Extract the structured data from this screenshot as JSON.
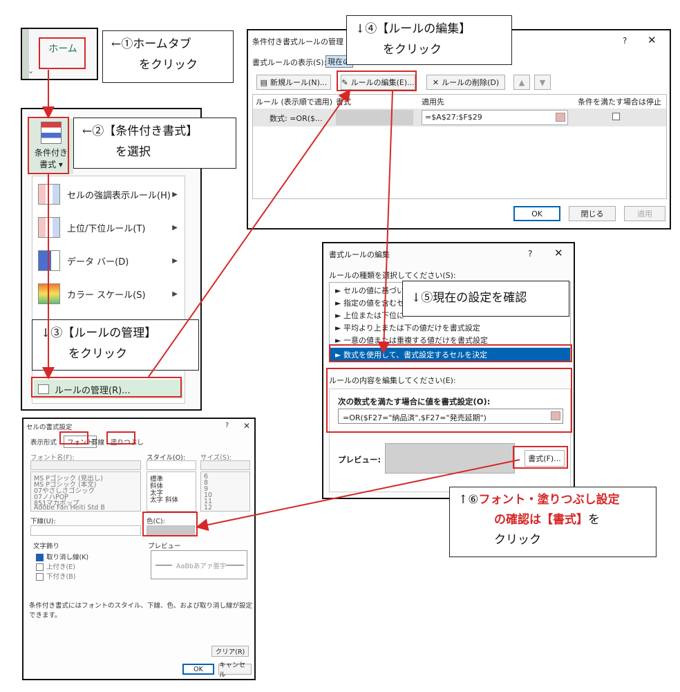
{
  "colors": {
    "accent_red": "#d62828",
    "excel_green": "#217346",
    "selected_blue": "#0063b1"
  },
  "home_tab": {
    "label": "ホーム"
  },
  "callouts": {
    "c1": [
      "←①ホームタブ",
      "をクリック"
    ],
    "c2": [
      "←②【条件付き書式】",
      "を選択"
    ],
    "c3": [
      "↓③【ルールの管理】",
      "をクリック"
    ],
    "c4": [
      "↓④【ルールの編集】",
      "をクリック"
    ],
    "c5": "↓⑤現在の設定を確認",
    "c6": {
      "prefix": "↑⑥",
      "red1": "フォント・塗りつぶし設定",
      "red2": "の確認は【書式】",
      "suffix": "を",
      "line3": "クリック"
    }
  },
  "cond_format_button": {
    "line1": "条件付き",
    "line2": "書式 ▾"
  },
  "cf_menu": {
    "items": [
      {
        "label": "セルの強調表示ルール(H)",
        "icon": "highlight-rules-icon"
      },
      {
        "label": "上位/下位ルール(T)",
        "icon": "top-bottom-icon"
      },
      {
        "label": "データ バー(D)",
        "icon": "data-bar-icon"
      },
      {
        "label": "カラー スケール(S)",
        "icon": "color-scale-icon"
      }
    ],
    "manage": "ルールの管理(R)..."
  },
  "rules_manager": {
    "title": "条件付き書式ルールの管理",
    "show_label": "書式ルールの表示(S):",
    "show_value": "現在の",
    "new_rule": "新規ルール(N)...",
    "edit_rule": "ルールの編集(E)...",
    "delete_rule": "ルールの削除(D)",
    "columns": [
      "ルール (表示順で適用)",
      "書式",
      "適用先",
      "条件を満たす場合は停止"
    ],
    "row": {
      "rule": "数式: =OR($...",
      "applies": "=$A$27:$F$29"
    },
    "ok": "OK",
    "close": "閉じる",
    "apply": "適用"
  },
  "edit_rule_dialog": {
    "title": "書式ルールの編集",
    "type_label": "ルールの種類を選択してください(S):",
    "types": [
      "► セルの値に基づいて",
      "► 指定の値を含むセ",
      "► 上位または下位に",
      "► 平均より上または下の値だけを書式設定",
      "► 一意の値または重複する値だけを書式設定",
      "► 数式を使用して、書式設定するセルを決定"
    ],
    "edit_label": "ルールの内容を編集してください(E):",
    "formula_label": "次の数式を満たす場合に値を書式設定(O):",
    "formula": "=OR($F27=\"納品済\",$F27=\"発売延期\")",
    "preview_label": "プレビュー:",
    "format_button": "書式(F)..."
  },
  "format_cells": {
    "title": "セルの書式設定",
    "tabs": [
      "表示形式",
      "フォント",
      "罫線",
      "塗りつぶし"
    ],
    "font_label": "フォント名(F):",
    "fonts": [
      "MS Pゴシック (見出し)",
      "MS Pゴシック (本文)",
      "07やさしさゴシック",
      "07ノハPOP",
      "851マカポップ",
      "Adobe Fan Heiti Std B"
    ],
    "style_label": "スタイル(O):",
    "styles": [
      "標準",
      "斜体",
      "太字",
      "太字 斜体"
    ],
    "size_label": "サイズ(S):",
    "sizes": [
      "6",
      "8",
      "9",
      "10",
      "11",
      "12"
    ],
    "underline_label": "下線(U):",
    "color_label": "色(C):",
    "effects_label": "文字飾り",
    "effects": [
      "取り消し線(K)",
      "上付き(E)",
      "下付き(B)"
    ],
    "preview_label": "プレビュー",
    "preview_text": "AaBbあアァ亜宇",
    "note": "条件付き書式にはフォントのスタイル、下線、色、および取り消し線が設定できます。",
    "clear": "クリア(R)",
    "ok": "OK",
    "cancel": "キャンセル"
  }
}
